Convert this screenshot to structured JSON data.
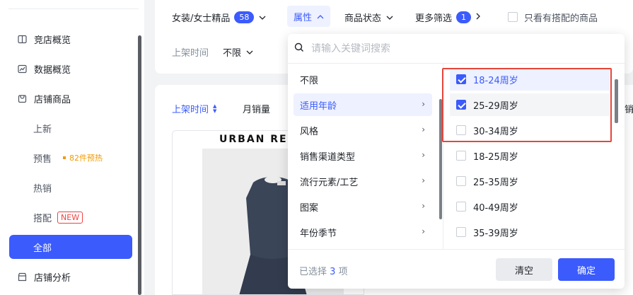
{
  "sidebar": {
    "items": [
      {
        "label": "竞店概览",
        "icon": "book-icon"
      },
      {
        "label": "数据概览",
        "icon": "chart-icon"
      },
      {
        "label": "店铺商品",
        "icon": "shop-bag-icon"
      }
    ],
    "sub_items": [
      {
        "label": "上新"
      },
      {
        "label": "预售",
        "hot": "82件预热"
      },
      {
        "label": "热销"
      },
      {
        "label": "搭配",
        "tag": "NEW"
      },
      {
        "label": "全部"
      }
    ],
    "analysis": {
      "label": "店铺分析",
      "icon": "store-icon"
    }
  },
  "filters": {
    "category": {
      "label": "女装/女士精品",
      "count": "58"
    },
    "attribute": {
      "label": "属性"
    },
    "status": {
      "label": "商品状态"
    },
    "more": {
      "label": "更多筛选",
      "count": "1"
    },
    "matched_only": {
      "label": "只看有搭配的商品"
    },
    "shelf_time": {
      "label": "上架时间",
      "value": "不限"
    }
  },
  "sort": {
    "shelf_time": "上架时间",
    "monthly_sales": "月销量",
    "edge_text": "销"
  },
  "product": {
    "brand": "URBAN RE"
  },
  "dropdown": {
    "search_placeholder": "请输入关键词搜索",
    "categories": [
      "不限",
      "适用年龄",
      "风格",
      "销售渠道类型",
      "流行元素/工艺",
      "图案",
      "年份季节"
    ],
    "selected_category": "适用年龄",
    "options": [
      {
        "label": "18-24周岁",
        "checked": true
      },
      {
        "label": "25-29周岁",
        "checked": true
      },
      {
        "label": "30-34周岁",
        "checked": false
      },
      {
        "label": "18-25周岁",
        "checked": false
      },
      {
        "label": "25-35周岁",
        "checked": false
      },
      {
        "label": "40-49周岁",
        "checked": false
      },
      {
        "label": "35-39周岁",
        "checked": false
      }
    ],
    "footer": {
      "selected_prefix": "已选择",
      "selected_count": "3",
      "selected_suffix": "项",
      "clear_label": "清空",
      "confirm_label": "确定"
    }
  },
  "colors": {
    "accent": "#3b5bfd",
    "highlight_border": "#e5453b",
    "hot": "#f29a00",
    "new_tag": "#f04142"
  }
}
